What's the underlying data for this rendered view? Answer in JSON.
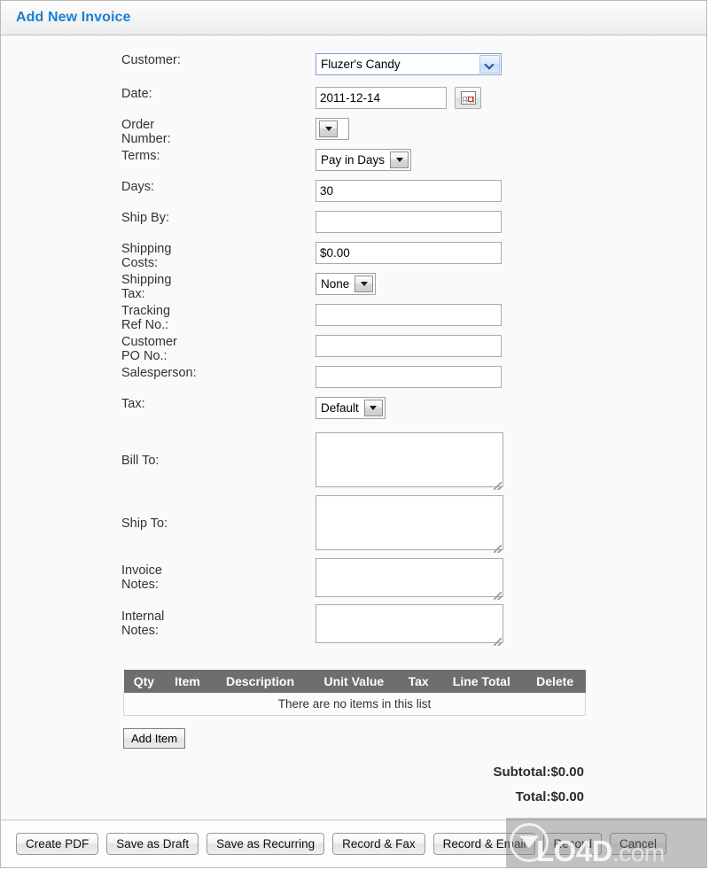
{
  "window": {
    "title": "Add New Invoice"
  },
  "form": {
    "fields": [
      {
        "label": "Customer:",
        "type": "select",
        "value": "Fluzer's Candy",
        "style": "blue"
      },
      {
        "label": "Date:",
        "type": "date",
        "value": "2011-12-14",
        "icon": "calendar-icon"
      },
      {
        "label": "Order Number:",
        "type": "select",
        "value": "",
        "style": "empty"
      },
      {
        "label": "Terms:",
        "type": "select",
        "value": "Pay in Days",
        "style": "plain"
      },
      {
        "label": "Days:",
        "type": "text",
        "value": "30"
      },
      {
        "label": "Ship By:",
        "type": "text",
        "value": ""
      },
      {
        "label": "Shipping Costs:",
        "type": "text",
        "value": "$0.00"
      },
      {
        "label": "Shipping Tax:",
        "type": "select",
        "value": "None",
        "style": "plain"
      },
      {
        "label": "Tracking Ref No.:",
        "type": "text",
        "value": ""
      },
      {
        "label": "Customer PO No.:",
        "type": "text",
        "value": ""
      },
      {
        "label": "Salesperson:",
        "type": "text",
        "value": ""
      },
      {
        "label": "Tax:",
        "type": "select",
        "value": "Default",
        "style": "plain"
      },
      {
        "label": "Bill To:",
        "type": "textarea",
        "value": "",
        "size": "large"
      },
      {
        "label": "Ship To:",
        "type": "textarea",
        "value": "",
        "size": "large"
      },
      {
        "label": "Invoice Notes:",
        "type": "textarea",
        "value": "",
        "size": "small"
      },
      {
        "label": "Internal Notes:",
        "type": "textarea",
        "value": "",
        "size": "small"
      }
    ]
  },
  "items_table": {
    "columns": [
      "Qty",
      "Item",
      "Description",
      "Unit Value",
      "Tax",
      "Line Total",
      "Delete"
    ],
    "rows": [],
    "empty_message": "There are no items in this list",
    "add_item_label": "Add Item"
  },
  "totals": {
    "subtotal_label": "Subtotal:",
    "subtotal_value": "$0.00",
    "total_label": "Total:",
    "total_value": "$0.00",
    "subtotal_line": "Subtotal:$0.00",
    "total_line": "Total:$0.00"
  },
  "footer": {
    "buttons": [
      "Create PDF",
      "Save as Draft",
      "Save as Recurring",
      "Record & Fax",
      "Record & Email",
      "Record",
      "Cancel"
    ]
  },
  "watermark": {
    "name": "LO4D",
    "suffix": ".com"
  },
  "colors": {
    "title_blue": "#1a7fd4",
    "table_header_bg": "#6e6e6e",
    "page_bg": "#fafafa"
  }
}
